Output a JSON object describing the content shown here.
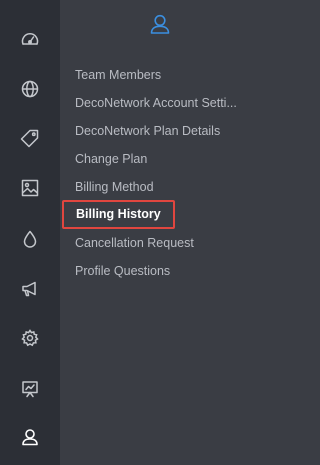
{
  "rail": {
    "icons": [
      {
        "name": "dashboard-gauge-icon"
      },
      {
        "name": "globe-icon"
      },
      {
        "name": "tag-icon"
      },
      {
        "name": "image-icon"
      },
      {
        "name": "droplet-icon"
      },
      {
        "name": "megaphone-icon"
      },
      {
        "name": "gear-icon"
      },
      {
        "name": "presentation-board-icon"
      },
      {
        "name": "user-icon",
        "active": true
      }
    ]
  },
  "panel": {
    "header_icon": "user-icon",
    "items": [
      {
        "label": "Team Members"
      },
      {
        "label": "DecoNetwork Account Setti..."
      },
      {
        "label": "DecoNetwork Plan Details"
      },
      {
        "label": "Change Plan"
      },
      {
        "label": "Billing Method"
      },
      {
        "label": "Billing History",
        "active": true
      },
      {
        "label": "Cancellation Request"
      },
      {
        "label": "Profile Questions"
      }
    ]
  },
  "colors": {
    "rail_bg": "#2c2f36",
    "panel_bg": "#3a3d44",
    "icon_color": "#c4c7cc",
    "accent_blue": "#3b8fe0",
    "highlight_red": "#e0463f"
  }
}
